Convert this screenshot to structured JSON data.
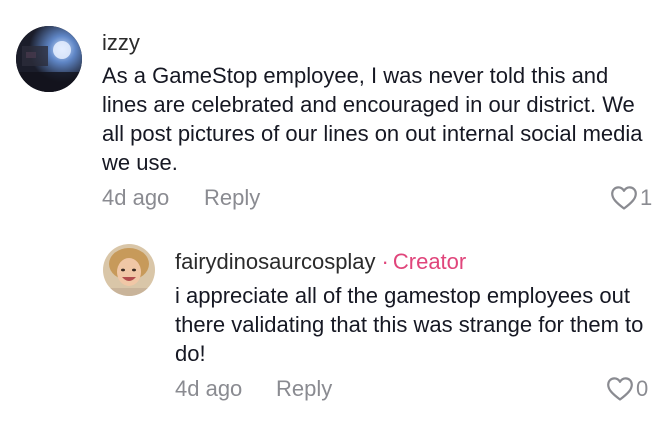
{
  "comments": [
    {
      "username": "izzy",
      "text": "As a GameStop employee, I was never told this and lines are celebrated and encouraged in our district. We all post pictures of our lines on out internal social media we use.",
      "time": "4d ago",
      "reply_label": "Reply",
      "like_count": "1",
      "avatar_icon": "user-avatar-icon"
    }
  ],
  "replies": [
    {
      "username": "fairydinosaurcosplay",
      "separator": "·",
      "badge": "Creator",
      "text": "i appreciate all of the gamestop employees out there validating that this was strange for them to do!",
      "time": "4d ago",
      "reply_label": "Reply",
      "like_count": "0",
      "avatar_icon": "creator-avatar-icon"
    }
  ],
  "colors": {
    "creator_accent": "#e0457b",
    "muted": "#8a8b91",
    "text": "#161823"
  }
}
